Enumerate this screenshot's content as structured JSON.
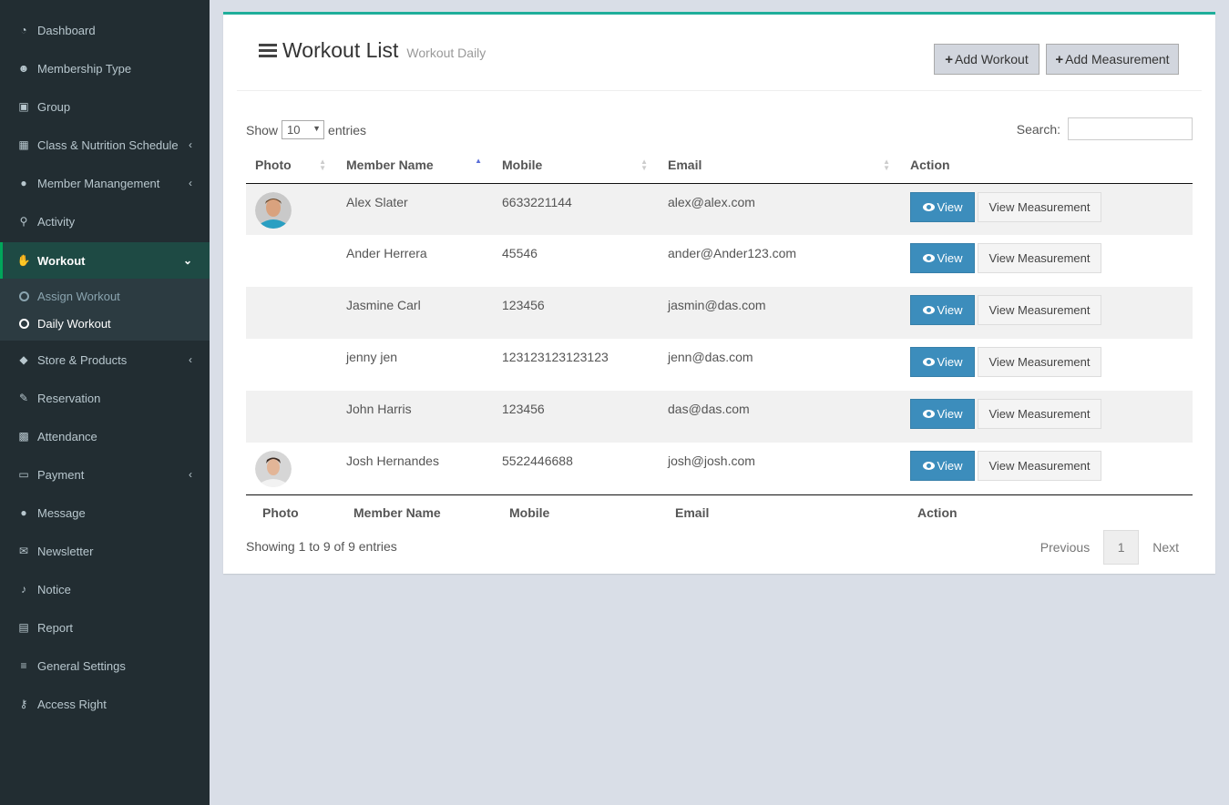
{
  "sidebar": {
    "items": [
      {
        "label": "Dashboard",
        "icon": "dashboard-icon",
        "glyph": "◔"
      },
      {
        "label": "Membership Type",
        "icon": "users-icon",
        "glyph": "☻"
      },
      {
        "label": "Group",
        "icon": "group-icon",
        "glyph": "▣"
      },
      {
        "label": "Class & Nutrition Schedule",
        "icon": "calendar-icon",
        "glyph": "▦"
      },
      {
        "label": "Member Manangement",
        "icon": "user-icon",
        "glyph": "●"
      },
      {
        "label": "Activity",
        "icon": "bicycle-icon",
        "glyph": "⚲"
      },
      {
        "label": "Workout",
        "icon": "hand-icon",
        "glyph": "✋"
      },
      {
        "label": "Store & Products",
        "icon": "tags-icon",
        "glyph": "◆"
      },
      {
        "label": "Reservation",
        "icon": "pencil-icon",
        "glyph": "✎"
      },
      {
        "label": "Attendance",
        "icon": "qrcode-icon",
        "glyph": "▩"
      },
      {
        "label": "Payment",
        "icon": "money-icon",
        "glyph": "▭"
      },
      {
        "label": "Message",
        "icon": "comment-icon",
        "glyph": "●"
      },
      {
        "label": "Newsletter",
        "icon": "envelope-icon",
        "glyph": "✉"
      },
      {
        "label": "Notice",
        "icon": "bell-icon",
        "glyph": "♪"
      },
      {
        "label": "Report",
        "icon": "file-icon",
        "glyph": "▤"
      },
      {
        "label": "General Settings",
        "icon": "sliders-icon",
        "glyph": "≡"
      },
      {
        "label": "Access Right",
        "icon": "key-icon",
        "glyph": "⚷"
      }
    ],
    "submenu": [
      "Assign Workout",
      "Daily Workout"
    ]
  },
  "header": {
    "title": "Workout List",
    "subtitle": "Workout Daily",
    "add_workout": "Add Workout",
    "add_measurement": "Add Measurement"
  },
  "controls": {
    "show": "Show",
    "entries_value": "10",
    "entries": "entries",
    "search_label": "Search:"
  },
  "table": {
    "columns": [
      "Photo",
      "Member Name",
      "Mobile",
      "Email",
      "Action"
    ],
    "rows": [
      {
        "name": "Alex Slater",
        "mobile": "6633221144",
        "email": "alex@alex.com"
      },
      {
        "name": "Ander Herrera",
        "mobile": "45546",
        "email": "ander@Ander123.com"
      },
      {
        "name": "Jasmine Carl",
        "mobile": "123456",
        "email": "jasmin@das.com"
      },
      {
        "name": "jenny jen",
        "mobile": "123123123123123",
        "email": "jenn@das.com"
      },
      {
        "name": "John Harris",
        "mobile": "123456",
        "email": "das@das.com"
      },
      {
        "name": "Josh Hernandes",
        "mobile": "5522446688",
        "email": "josh@josh.com"
      }
    ],
    "view_label": "View",
    "measurement_label": "View Measurement"
  },
  "footer": {
    "info": "Showing 1 to 9 of 9 entries",
    "previous": "Previous",
    "page": "1",
    "next": "Next"
  }
}
